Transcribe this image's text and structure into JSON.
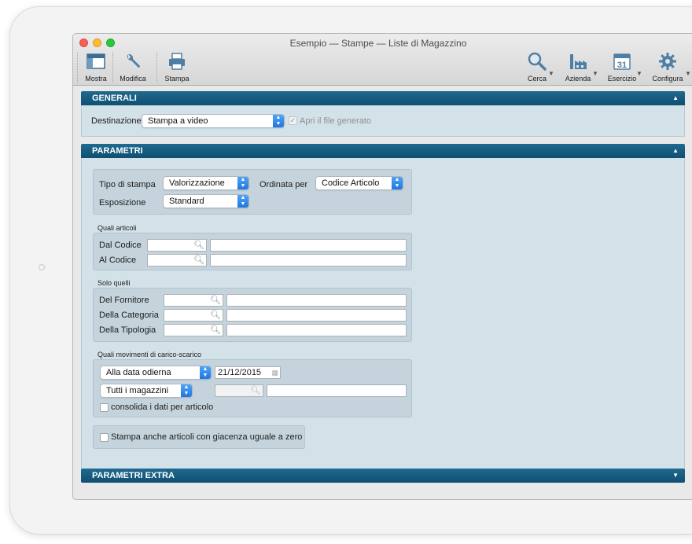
{
  "window": {
    "title": "Esempio — Stampe — Liste di Magazzino"
  },
  "toolbar": {
    "left": [
      {
        "label": "Mostra",
        "icon": "show-window-icon"
      },
      {
        "label": "Modifica",
        "icon": "wrench-icon"
      },
      {
        "label": "Stampa",
        "icon": "printer-icon"
      }
    ],
    "right": [
      {
        "label": "Cerca",
        "icon": "magnifier-icon"
      },
      {
        "label": "Azienda",
        "icon": "factory-icon"
      },
      {
        "label": "Esercizio",
        "icon": "calendar-icon",
        "calendar_day": "31"
      },
      {
        "label": "Configura",
        "icon": "gear-icon"
      }
    ]
  },
  "generali": {
    "header": "GENERALI",
    "destinazione_label": "Destinazione",
    "destinazione_value": "Stampa a video",
    "apri_file_label": "Apri il file generato"
  },
  "parametri": {
    "header": "PARAMETRI",
    "tipo_label": "Tipo di stampa",
    "tipo_value": "Valorizzazione",
    "ordinata_label": "Ordinata per",
    "ordinata_value": "Codice Articolo",
    "esposizione_label": "Esposizione",
    "esposizione_value": "Standard",
    "quali_articoli": {
      "title": "Quali articoli",
      "dal_label": "Dal Codice",
      "al_label": "Al Codice"
    },
    "solo_quelli": {
      "title": "Solo quelli",
      "fornitore_label": "Del Fornitore",
      "categoria_label": "Della Categoria",
      "tipologia_label": "Della Tipologia"
    },
    "movimenti": {
      "title": "Quali movimenti di carico-scarico",
      "data_mode": "Alla data odierna",
      "date": "21/12/2015",
      "magazzini": "Tutti i magazzini",
      "consolida_label": "consolida i dati per articolo"
    },
    "giacenza_label": "Stampa anche articoli con giacenza uguale a zero"
  },
  "parametri_extra": {
    "header": "PARAMETRI EXTRA"
  }
}
